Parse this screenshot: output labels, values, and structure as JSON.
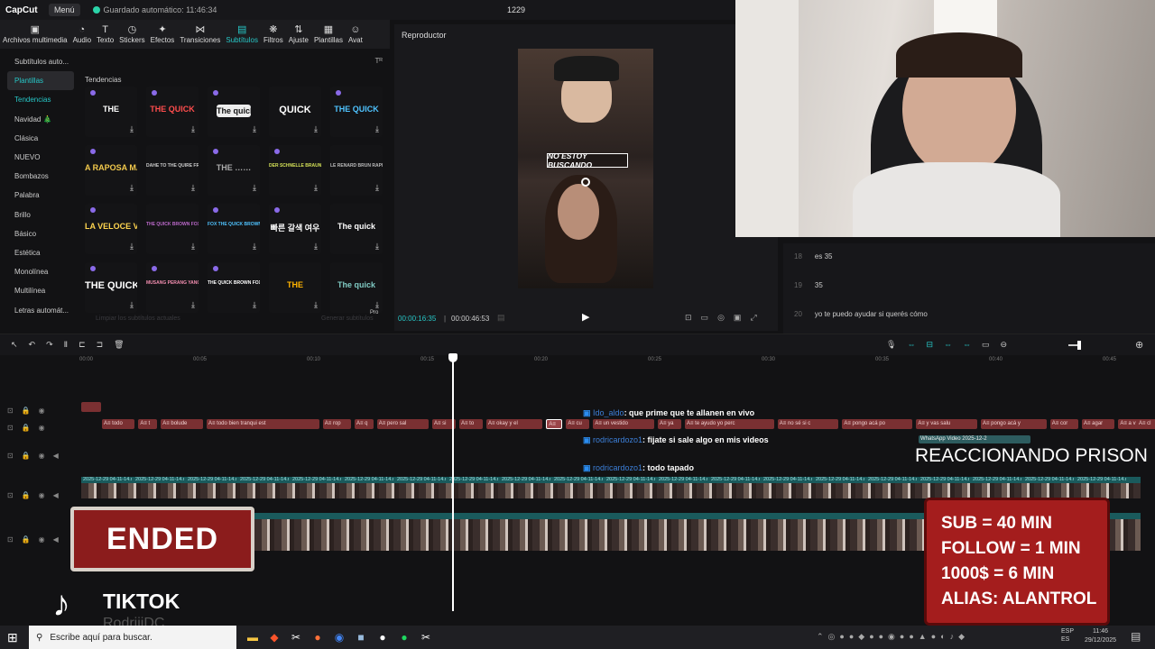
{
  "app": {
    "logo": "CapCut",
    "menu_label": "Menú",
    "autosave_text": "Guardado automático: 11:46:34",
    "project_name": "1229"
  },
  "toolbar": [
    {
      "label": "Archivos multimedia",
      "icon": "media-icon",
      "glyph": "▣"
    },
    {
      "label": "Audio",
      "icon": "audio-icon",
      "glyph": "◔"
    },
    {
      "label": "Texto",
      "icon": "text-icon",
      "glyph": "T"
    },
    {
      "label": "Stickers",
      "icon": "sticker-icon",
      "glyph": "◷"
    },
    {
      "label": "Efectos",
      "icon": "effects-icon",
      "glyph": "✦"
    },
    {
      "label": "Transiciones",
      "icon": "transition-icon",
      "glyph": "⋈"
    },
    {
      "label": "Subtítulos",
      "icon": "subtitles-icon",
      "glyph": "▤",
      "active": true
    },
    {
      "label": "Filtros",
      "icon": "filters-icon",
      "glyph": "❋"
    },
    {
      "label": "Ajuste",
      "icon": "adjust-icon",
      "glyph": "⇅"
    },
    {
      "label": "Plantillas",
      "icon": "templates-icon",
      "glyph": "▦"
    },
    {
      "label": "Avat",
      "icon": "avatar-icon",
      "glyph": "☺"
    }
  ],
  "sidenav": [
    {
      "label": "Subtítulos auto..."
    },
    {
      "label": "Plantillas",
      "selected": true,
      "teal": true
    },
    {
      "label": "Tendencias",
      "teal": true
    },
    {
      "label": "Navidad 🎄"
    },
    {
      "label": "Clásica"
    },
    {
      "label": "NUEVO"
    },
    {
      "label": "Bombazos"
    },
    {
      "label": "Palabra"
    },
    {
      "label": "Brillo"
    },
    {
      "label": "Básico"
    },
    {
      "label": "Estética"
    },
    {
      "label": "Monolínea"
    },
    {
      "label": "Multilínea"
    },
    {
      "label": "Letras automát..."
    }
  ],
  "grid": {
    "section_title": "Tendencias",
    "sort_icon": "Tᴿ",
    "footer_left": "Limpiar los subtítulos actuales",
    "footer_right": "Generar subtítulos",
    "pro_label": "Pro",
    "tiles": [
      {
        "text": "THE",
        "color": "#ffffff"
      },
      {
        "text": "THE QUICK",
        "color": "#ff4d4d"
      },
      {
        "text": "The quick",
        "color": "#111111"
      },
      {
        "text": "QUICK",
        "color": "#ffffff"
      },
      {
        "text": "THE QUICK",
        "color": "#4fc3ff"
      },
      {
        "text": "A RAPOSA MARROM",
        "color": "#f2c94c"
      },
      {
        "text": "DAHE TO THE QUIRE FROWN SEA",
        "color": "#cccccc"
      },
      {
        "text": "THE ……",
        "color": "#aaaaaa"
      },
      {
        "text": "DER SCHNELLE BRAUNE",
        "color": "#d4e157"
      },
      {
        "text": "LE RENARD BRUN RAPIDE",
        "color": "#bbbbbb"
      },
      {
        "text": "LA VELOCE VOLPE",
        "color": "#ffd54f"
      },
      {
        "text": "THE QUICK BROWN FOX",
        "color": "#ba68c8"
      },
      {
        "text": "FOX THE QUICK BROWN",
        "color": "#4fc3ff"
      },
      {
        "text": "빠른 갈색 여우",
        "color": "#ffffff"
      },
      {
        "text": "The quick",
        "color": "#ffffff"
      },
      {
        "text": "THE QUICK",
        "color": "#ffffff"
      },
      {
        "text": "MUSANG PERANG YANG TANGKAS",
        "color": "#f48fb1"
      },
      {
        "text": "THE QUICK BROWN FOX",
        "color": "#ffffff"
      },
      {
        "text": "THE",
        "color": "#ffb300"
      },
      {
        "text": "The quick",
        "color": "#80cbc4"
      }
    ]
  },
  "player": {
    "title": "Reproductor",
    "overlay_text": "NO ESTOY BUSCANDO",
    "time_current": "00:00:16:35",
    "time_total": "00:00:46:53"
  },
  "transcript": [
    {
      "n": "18",
      "text": "es 35"
    },
    {
      "n": "19",
      "text": "35"
    },
    {
      "n": "20",
      "text": "yo te puedo ayudar si querés cómo"
    }
  ],
  "ruler": [
    "00:00",
    "00:05",
    "00:10",
    "00:15",
    "00:20",
    "00:25",
    "00:30",
    "00:35",
    "00:40",
    "00:45"
  ],
  "subtitle_clips": [
    "A≡ todo",
    "A≡ t",
    "A≡ bolude",
    "A≡ todo bien tranqui est",
    "A≡ rop",
    "A≡ q",
    "A≡ pero sal",
    "A≡ si",
    "A≡ to",
    "A≡ okay y el",
    "A≡",
    "A≡ cu",
    "A≡ un vestido",
    "A≡ ya",
    "A≡ te ayudo yo perc",
    "A≡ no sé si c",
    "A≡ pongo acá po",
    "A≡ y vas salu",
    "A≡ pongo acá y",
    "A≡ cor",
    "A≡ agar",
    "A≡ a v",
    "A≡ cl"
  ],
  "video_clip_label": "2025-12-29 04-11-14.mp4",
  "whatsapp_label": "WhatsApp Video 2025-12-2",
  "stream": {
    "chat": [
      {
        "user": "Ido_aldo",
        "msg": ": que prime que te allanen en vivo"
      },
      {
        "user": "rodricardozo1",
        "msg": ": fijate si sale algo en mis videos"
      },
      {
        "user": "rodricardozo1",
        "msg": ": todo tapado"
      }
    ],
    "reacc": "REACCIONANDO PRISON",
    "ended": "ENDED",
    "sub_lines": [
      "SUB = 40 MIN",
      "FOLLOW = 1 MIN",
      "1000$ = 6 MIN",
      "ALIAS: ALANTROL"
    ],
    "tiktok": "TIKTOK",
    "tiktok_user": "RodriiiDC"
  },
  "taskbar": {
    "search_placeholder": "Escribe aquí para buscar.",
    "lang": "ESP\nES",
    "time": "11:46",
    "date": "29/12/2025"
  }
}
